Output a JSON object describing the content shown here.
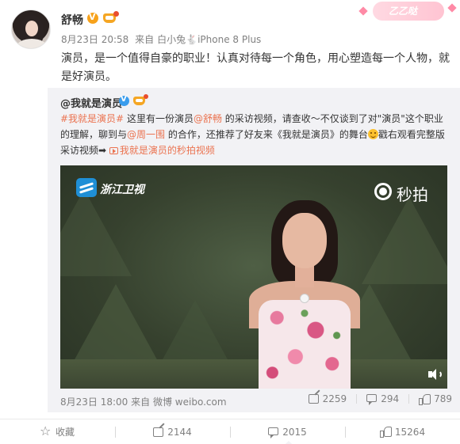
{
  "post": {
    "author": "舒畅",
    "decor_text": "乙乙哒",
    "meta": {
      "date": "8月23日 20:58",
      "source_prefix": "来自",
      "source": "白小兔🐇iPhone 8 Plus"
    },
    "text": "演员，是一个值得自豪的职业！认真对待每一个角色，用心塑造每一个人物，就是好演员。"
  },
  "retweet": {
    "author": "@我就是演员",
    "text": {
      "hashtag": "#我就是演员#",
      "part1": " 这里有一份演员",
      "mention1": "@舒畅",
      "part2": " 的采访视频，请查收～不仅谈到了对\"演员\"这个职业的理解，聊到与",
      "mention2": "@周一围",
      "part3": " 的合作，还推荐了好友来《我就是演员》的舞台",
      "part4": "戳右观看完整版采访视频➡",
      "link": "我就是演员的秒拍视频"
    },
    "video": {
      "channel": "浙江卫视",
      "watermark": "秒拍"
    },
    "meta": {
      "date": "8月23日 18:00",
      "source_prefix": "来自",
      "source": "微博 weibo.com"
    },
    "stats": {
      "reposts": "2259",
      "comments": "294",
      "likes": "789"
    }
  },
  "action_bar": {
    "favorite": "收藏",
    "reposts": "2144",
    "comments": "2015",
    "likes": "15264"
  }
}
